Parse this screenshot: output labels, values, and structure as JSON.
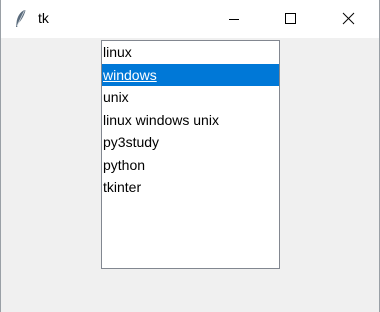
{
  "window": {
    "title": "tk",
    "icon": "feather-icon"
  },
  "controls": {
    "minimize_icon": "minimize-icon",
    "maximize_icon": "maximize-icon",
    "close_icon": "close-icon"
  },
  "listbox": {
    "selected_index": 1,
    "selection_color": "#0078d7",
    "items": [
      {
        "label": "linux"
      },
      {
        "label": "windows"
      },
      {
        "label": "unix"
      },
      {
        "label": "linux windows unix"
      },
      {
        "label": "py3study"
      },
      {
        "label": "python"
      },
      {
        "label": "tkinter"
      }
    ]
  }
}
